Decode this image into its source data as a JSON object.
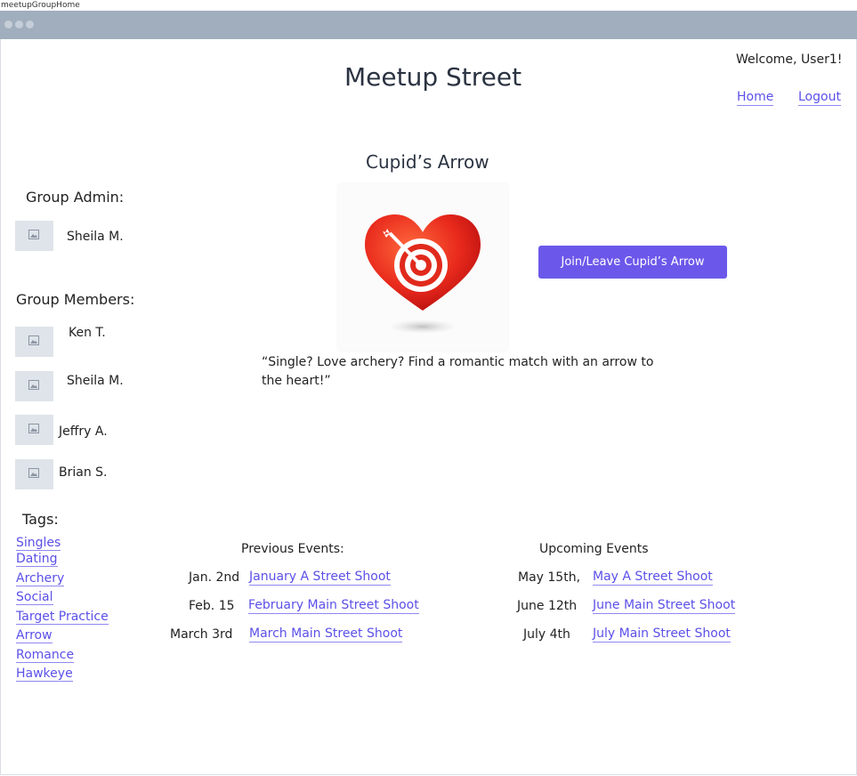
{
  "window": {
    "title": "meetupGroupHome"
  },
  "header": {
    "site_title": "Meetup Street",
    "welcome": "Welcome, User1!",
    "nav": {
      "home": "Home",
      "logout": "Logout"
    }
  },
  "group": {
    "name": "Cupid’s Arrow",
    "description": "“Single? Love archery? Find a romantic match with an arrow to the heart!”",
    "join_button": "Join/Leave Cupid’s Arrow",
    "image_icon": "heart-target-arrow"
  },
  "admin": {
    "heading": "Group Admin:",
    "name": "Sheila M."
  },
  "members": {
    "heading": "Group Members:",
    "names": [
      "Ken T.",
      "Sheila M.",
      "Jeffry A.",
      "Brian S."
    ]
  },
  "tags": {
    "heading": "Tags:",
    "items": [
      "Singles",
      "Dating",
      "Archery",
      "Social",
      "Target Practice",
      "Arrow",
      "Romance",
      "Hawkeye"
    ]
  },
  "previous_events": {
    "heading": "Previous Events:",
    "items": [
      {
        "date": "Jan. 2nd",
        "title": "January A Street Shoot"
      },
      {
        "date": "Feb. 15",
        "title": "February Main Street Shoot"
      },
      {
        "date": "March 3rd",
        "title": "March Main Street Shoot"
      }
    ]
  },
  "upcoming_events": {
    "heading": "Upcoming Events",
    "items": [
      {
        "date": "May 15th,",
        "title": "May A Street Shoot"
      },
      {
        "date": "June 12th",
        "title": "June Main Street Shoot"
      },
      {
        "date": "July 4th",
        "title": "July Main Street Shoot"
      }
    ]
  },
  "colors": {
    "accent": "#6b58ea",
    "link": "#5b50e8",
    "chrome": "#a0aebd"
  }
}
